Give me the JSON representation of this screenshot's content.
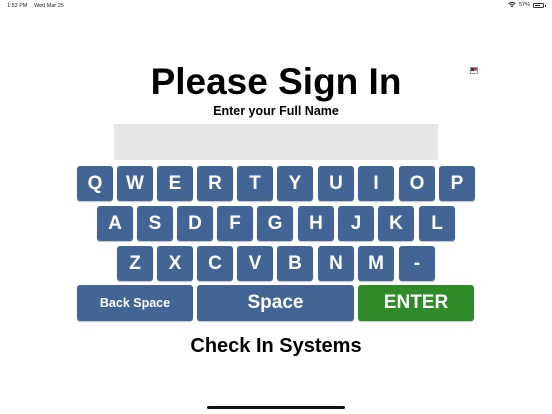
{
  "status_bar": {
    "time": "1:53 PM",
    "date": "Wed Mar 25",
    "battery": "57%",
    "icons": [
      "wifi-icon",
      "battery-icon"
    ]
  },
  "flag_icon": "us-flag-icon",
  "title": "Please Sign In",
  "subtitle": "Enter your Full Name",
  "name_input": {
    "value": "",
    "placeholder": ""
  },
  "keyboard": {
    "row1": [
      "Q",
      "W",
      "E",
      "R",
      "T",
      "Y",
      "U",
      "I",
      "O",
      "P"
    ],
    "row2": [
      "A",
      "S",
      "D",
      "F",
      "G",
      "H",
      "J",
      "K",
      "L"
    ],
    "row3": [
      "Z",
      "X",
      "C",
      "V",
      "B",
      "N",
      "M",
      "-"
    ],
    "back_space": "Back Space",
    "space": "Space",
    "enter": "ENTER"
  },
  "colors": {
    "key": "#436596",
    "enter": "#2f8a2a",
    "input": "#e6e6e6"
  },
  "footer": "Check In Systems"
}
